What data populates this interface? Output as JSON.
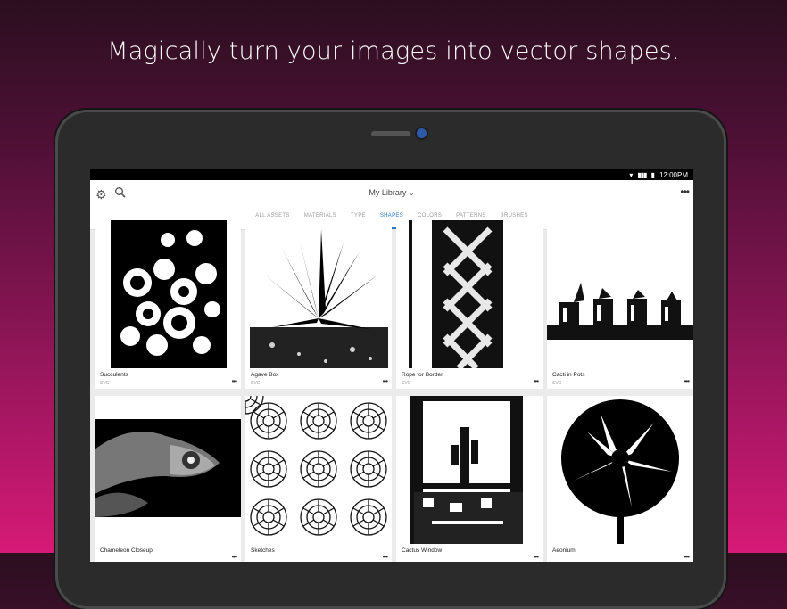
{
  "headline": "Magically turn your images into vector shapes.",
  "status": {
    "time": "12:00PM"
  },
  "appbar": {
    "library_label": "My Library",
    "more": "•••"
  },
  "tabs": [
    {
      "label": "ALL ASSETS",
      "active": false
    },
    {
      "label": "MATERIALS",
      "active": false
    },
    {
      "label": "TYPE",
      "active": false
    },
    {
      "label": "SHAPES",
      "active": true
    },
    {
      "label": "COLORS",
      "active": false
    },
    {
      "label": "PATTERNS",
      "active": false
    },
    {
      "label": "BRUSHES",
      "active": false
    }
  ],
  "cards": [
    {
      "name": "Succulents",
      "type": "SVG"
    },
    {
      "name": "Agave Box",
      "type": "SVG"
    },
    {
      "name": "Rope for Border",
      "type": "SVG"
    },
    {
      "name": "Cacti in Pots",
      "type": "SVG"
    },
    {
      "name": "Chameleon Closeup",
      "type": ""
    },
    {
      "name": "Sketches",
      "type": ""
    },
    {
      "name": "Cactus Window",
      "type": ""
    },
    {
      "name": "Aeonium",
      "type": ""
    }
  ],
  "card_more": "•••"
}
